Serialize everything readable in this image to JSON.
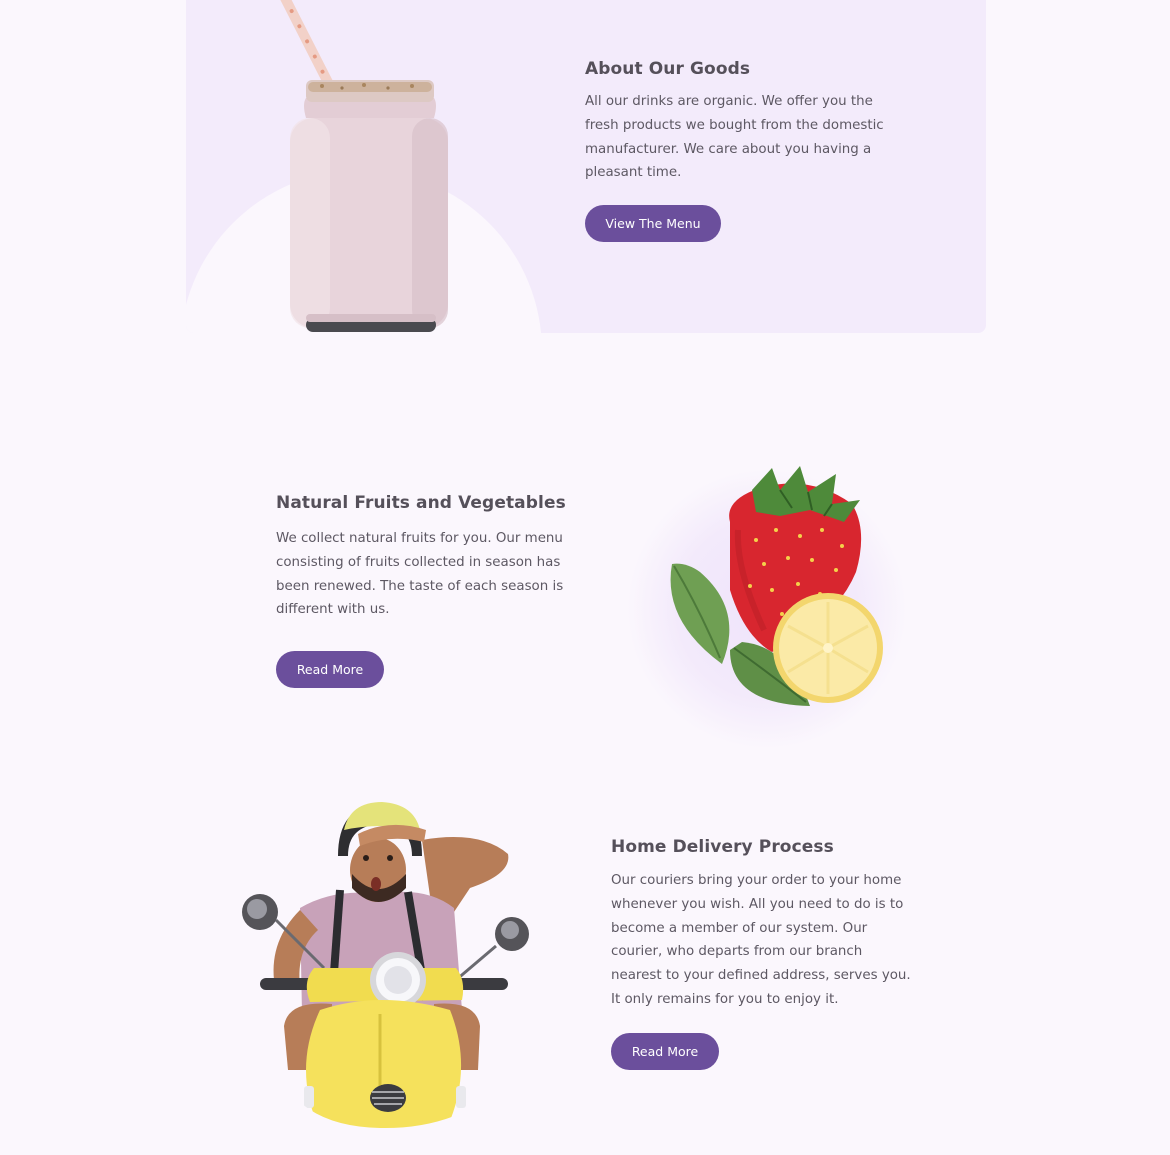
{
  "sections": {
    "about": {
      "title": "About Our Goods",
      "description": "All our drinks are organic. We offer you the fresh products we bought from the domestic manufacturer. We care about you having a pleasant time.",
      "button_label": "View The Menu"
    },
    "fruits": {
      "title": "Natural Fruits and Vegetables",
      "description": "We collect natural fruits for you. Our menu consisting of fruits collected in season has been renewed. The taste of each season is different with us.",
      "button_label": "Read More"
    },
    "delivery": {
      "title": "Home Delivery Process",
      "description": "Our couriers bring your order to your home whenever you wish. All you need to do is to become a member of our system. Our courier, who departs from our branch nearest to your defined address, serves you. It only remains for you to enjoy it.",
      "button_label": "Read More"
    }
  },
  "colors": {
    "page_background": "#fbf7fd",
    "panel_background": "#f3ebfb",
    "button_background": "#6b4f9c",
    "button_text": "#ffffff",
    "heading_text": "#55505a",
    "body_text": "#5d5863"
  },
  "images": {
    "about": "smoothie-jar-image",
    "fruits": "strawberry-lemon-image",
    "delivery": "scooter-courier-image"
  }
}
